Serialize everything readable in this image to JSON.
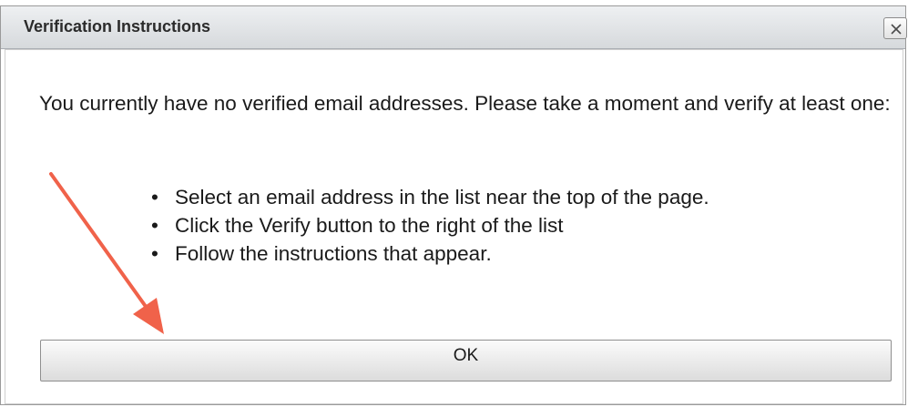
{
  "dialog": {
    "title": "Verification Instructions",
    "close_glyph": "×",
    "close_icon": "close-icon",
    "message": "You currently have no verified email addresses. Please take a moment and verify at least one:",
    "steps": [
      {
        "bullet": "•",
        "text": "Select an email address in the list near the top of the page."
      },
      {
        "bullet": "•",
        "text": "Click the Verify button to the right of the list"
      },
      {
        "bullet": "•",
        "text": "Follow the instructions that appear."
      }
    ],
    "ok_label": "OK"
  },
  "annotation": {
    "arrow_icon": "arrow-icon",
    "arrow_color": "#f0624a"
  },
  "colors": {
    "titlebar_top": "#eef0f2",
    "titlebar_bottom": "#d6d9dc",
    "text": "#1a1a1a"
  }
}
